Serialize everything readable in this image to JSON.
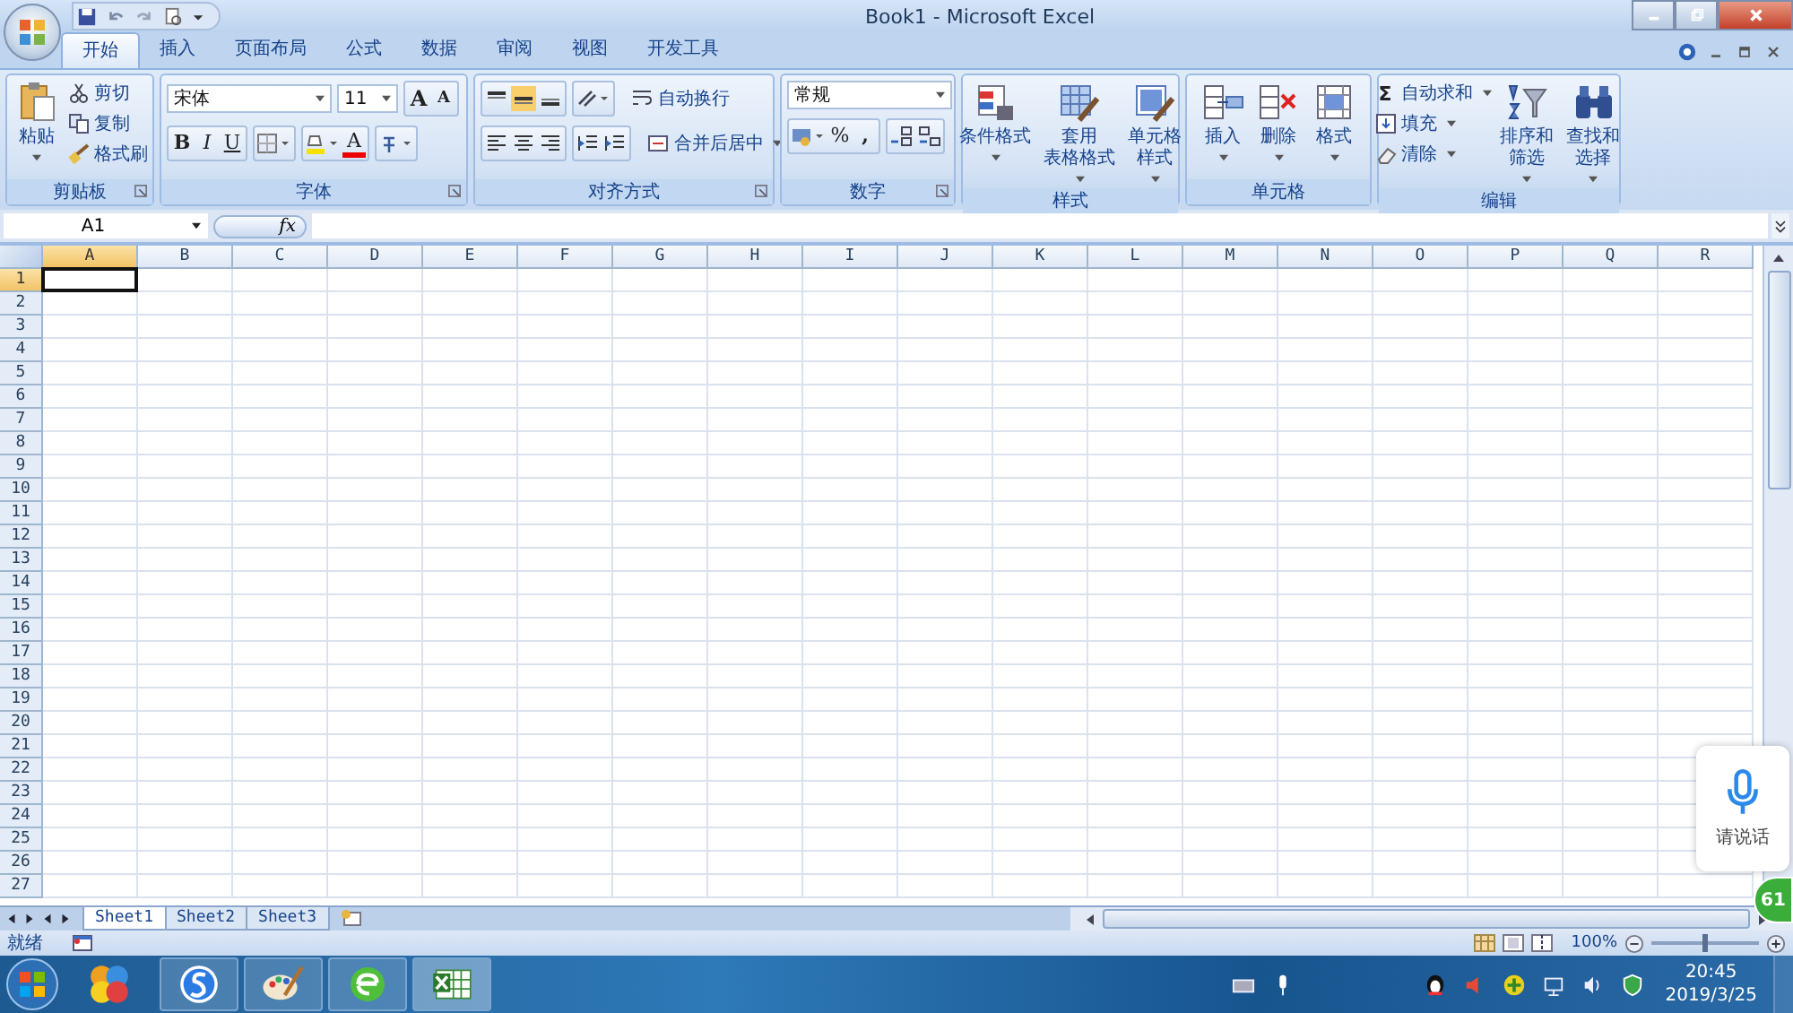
{
  "window": {
    "title": "Book1 - Microsoft Excel"
  },
  "tabs": [
    {
      "label": "开始",
      "selected": true
    },
    {
      "label": "插入",
      "selected": false
    },
    {
      "label": "页面布局",
      "selected": false
    },
    {
      "label": "公式",
      "selected": false
    },
    {
      "label": "数据",
      "selected": false
    },
    {
      "label": "审阅",
      "selected": false
    },
    {
      "label": "视图",
      "selected": false
    },
    {
      "label": "开发工具",
      "selected": false
    }
  ],
  "ribbon": {
    "clipboard": {
      "name": "剪贴板",
      "paste": "粘贴",
      "items": [
        "剪切",
        "复制",
        "格式刷"
      ]
    },
    "font": {
      "name": "字体",
      "font_name": "宋体",
      "font_size": "11",
      "grow": "A",
      "shrink": "A",
      "bold": "B",
      "italic": "I",
      "underline": "U",
      "font_color": "A"
    },
    "alignment": {
      "name": "对齐方式",
      "wrap_text": "自动换行",
      "merge_center": "合并后居中"
    },
    "number": {
      "name": "数字",
      "format": "常规",
      "percent": "%",
      "comma": ","
    },
    "styles": {
      "name": "样式",
      "items": [
        {
          "lines": [
            "条件格式"
          ]
        },
        {
          "lines": [
            "套用",
            "表格格式"
          ]
        },
        {
          "lines": [
            "单元格",
            "样式"
          ]
        }
      ]
    },
    "cells": {
      "name": "单元格",
      "items": [
        {
          "lines": [
            "插入"
          ]
        },
        {
          "lines": [
            "删除"
          ]
        },
        {
          "lines": [
            "格式"
          ]
        }
      ]
    },
    "editing": {
      "name": "编辑",
      "small": [
        {
          "symbol": "Σ",
          "label": "自动求和"
        },
        {
          "label": "填充"
        },
        {
          "label": "清除"
        }
      ],
      "large": [
        {
          "lines": [
            "排序和",
            "筛选"
          ]
        },
        {
          "lines": [
            "查找和",
            "选择"
          ]
        }
      ]
    }
  },
  "formula_bar": {
    "name_box": "A1",
    "fx": "fx"
  },
  "columns": [
    {
      "label": "A",
      "selected": true
    },
    {
      "label": "B",
      "selected": false
    },
    {
      "label": "C",
      "selected": false
    },
    {
      "label": "D",
      "selected": false
    },
    {
      "label": "E",
      "selected": false
    },
    {
      "label": "F",
      "selected": false
    },
    {
      "label": "G",
      "selected": false
    },
    {
      "label": "H",
      "selected": false
    },
    {
      "label": "I",
      "selected": false
    },
    {
      "label": "J",
      "selected": false
    },
    {
      "label": "K",
      "selected": false
    },
    {
      "label": "L",
      "selected": false
    },
    {
      "label": "M",
      "selected": false
    },
    {
      "label": "N",
      "selected": false
    },
    {
      "label": "O",
      "selected": false
    },
    {
      "label": "P",
      "selected": false
    },
    {
      "label": "Q",
      "selected": false
    },
    {
      "label": "R",
      "selected": false
    }
  ],
  "rows": [
    {
      "label": "1",
      "selected": true
    },
    {
      "label": "2",
      "selected": false
    },
    {
      "label": "3",
      "selected": false
    },
    {
      "label": "4",
      "selected": false
    },
    {
      "label": "5",
      "selected": false
    },
    {
      "label": "6",
      "selected": false
    },
    {
      "label": "7",
      "selected": false
    },
    {
      "label": "8",
      "selected": false
    },
    {
      "label": "9",
      "selected": false
    },
    {
      "label": "10",
      "selected": false
    },
    {
      "label": "11",
      "selected": false
    },
    {
      "label": "12",
      "selected": false
    },
    {
      "label": "13",
      "selected": false
    },
    {
      "label": "14",
      "selected": false
    },
    {
      "label": "15",
      "selected": false
    },
    {
      "label": "16",
      "selected": false
    },
    {
      "label": "17",
      "selected": false
    },
    {
      "label": "18",
      "selected": false
    },
    {
      "label": "19",
      "selected": false
    },
    {
      "label": "20",
      "selected": false
    },
    {
      "label": "21",
      "selected": false
    },
    {
      "label": "22",
      "selected": false
    },
    {
      "label": "23",
      "selected": false
    },
    {
      "label": "24",
      "selected": false
    },
    {
      "label": "25",
      "selected": false
    },
    {
      "label": "26",
      "selected": false
    },
    {
      "label": "27",
      "selected": false
    }
  ],
  "sheets": [
    {
      "label": "Sheet1",
      "selected": true
    },
    {
      "label": "Sheet2",
      "selected": false
    },
    {
      "label": "Sheet3",
      "selected": false
    }
  ],
  "status_bar": {
    "text": "就绪",
    "zoom": "100%",
    "zoom_slider": {
      "level": 0.5
    }
  },
  "voice_widget": {
    "label": "请说话"
  },
  "badge": "61",
  "taskbar": {
    "time": "20:45",
    "date": "2019/3/25"
  }
}
